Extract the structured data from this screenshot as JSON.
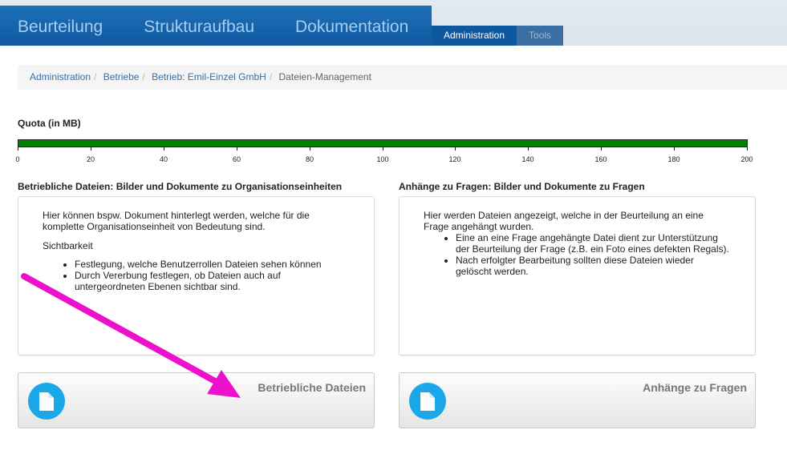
{
  "header": {
    "main_nav": [
      "Beurteilung",
      "Strukturaufbau",
      "Dokumentation"
    ],
    "sub_nav": [
      {
        "label": "Administration",
        "active": true
      },
      {
        "label": "Tools",
        "active": false
      }
    ]
  },
  "breadcrumb": {
    "items": [
      "Administration",
      "Betriebe",
      "Betrieb: Emil-Einzel GmbH"
    ],
    "current": "Dateien-Management"
  },
  "quota": {
    "title": "Quota (in MB)",
    "used_fraction": 1.0,
    "ticks": [
      "0",
      "20",
      "40",
      "60",
      "80",
      "100",
      "120",
      "140",
      "160",
      "180",
      "200"
    ],
    "bar_color": "#008000"
  },
  "left_section": {
    "title": "Betriebliche Dateien: Bilder und Dokumente zu Organisationseinheiten",
    "intro": "Hier können bspw. Dokument hinterlegt werden, welche für die komplette Organisationseinheit von Bedeutung sind.",
    "subheading": "Sichtbarkeit",
    "bullets": [
      "Festlegung, welche Benutzerrollen Dateien sehen können",
      "Durch Vererbung festlegen, ob Dateien auch auf untergeordneten Ebenen sichtbar sind."
    ],
    "tile_label": "Betriebliche Dateien"
  },
  "right_section": {
    "title": "Anhänge zu Fragen: Bilder und Dokumente zu Fragen",
    "intro": "Hier werden Dateien angezeigt, welche in der Beurteilung an eine Frage angehängt wurden.",
    "bullets": [
      "Eine an eine Frage angehängte Datei dient zur Unterstützung der Beurteilung der Frage (z.B. ein Foto eines defekten Regals).",
      "Nach erfolgter Bearbeitung sollten diese Dateien wieder gelöscht werden."
    ],
    "tile_label": "Anhänge zu Fragen"
  },
  "colors": {
    "nav_blue": "#0f5aa1",
    "tile_icon": "#1aa8ea",
    "annotation_arrow": "#ee11cc"
  },
  "icons": {
    "tile_icon": "document-icon"
  }
}
